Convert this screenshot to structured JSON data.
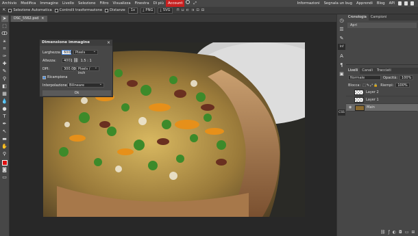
{
  "menu": {
    "items": [
      "Archivio",
      "Modifica",
      "Immagine",
      "Livello",
      "Selezione",
      "Filtro",
      "Visualizza",
      "Finestra",
      "Di più",
      "Account"
    ],
    "right": [
      "Informazioni",
      "Segnala un bug",
      "Apprendi",
      "Blog",
      "API"
    ]
  },
  "options": {
    "auto_select": "Selezione Automatica",
    "transform_controls": "Controlli trasformazione",
    "distances": "Distanze",
    "zoom": "1x",
    "png": "PNG",
    "svg": "SVG"
  },
  "document": {
    "tab": "DSC_5562.psd",
    "close": "×"
  },
  "dialog": {
    "title": "Dimensione immagine",
    "close": "×",
    "width_label": "Larghezza:",
    "width_value": "6000",
    "width_unit": "Pixels",
    "height_label": "Altezza:",
    "height_value": "4001",
    "ratio": "1.5 : 1",
    "dpi_label": "DPI:",
    "dpi_value": "300.000",
    "dpi_unit": "Pixels / inch",
    "resample_label": "Ricampiona",
    "interp_label": "Interpolazione:",
    "interp_value": "Bilineare",
    "ok": "Ok"
  },
  "side_panel": {
    "tag1": "Inf",
    "tag2": "CSS"
  },
  "history": {
    "tabs": [
      "Cronologia",
      "Campioni"
    ],
    "rows": [
      "Apri"
    ]
  },
  "layers": {
    "tabs": [
      "Livelli",
      "Canali",
      "Tracciati"
    ],
    "blend": "Normale",
    "opacity_label": "Opacità:",
    "opacity": "100%",
    "lock_label": "Blocca:",
    "fill_label": "Riempi:",
    "fill": "100%",
    "items": [
      "Layer 2",
      "Layer 1",
      "Main"
    ]
  },
  "colors": {
    "accent": "#c72020",
    "foreground": "#e01010",
    "selection": "#5090e8"
  }
}
